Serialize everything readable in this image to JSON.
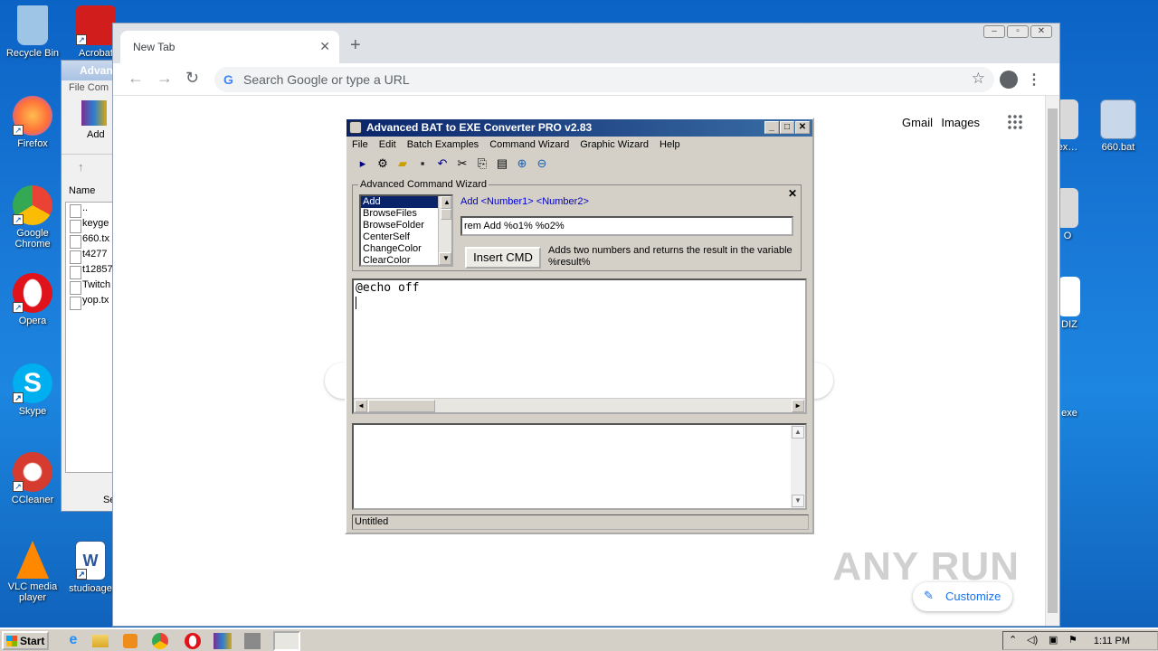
{
  "desktop_icons": [
    {
      "label": "Recycle Bin",
      "icon": "recycle-bin-icon",
      "color": "#9ec4e6"
    },
    {
      "label": "Acrobat",
      "icon": "acrobat-icon",
      "color": "#d21d1d"
    },
    {
      "label": "Firefox",
      "icon": "firefox-icon",
      "color": "#ff7139"
    },
    {
      "label": "Google Chrome",
      "icon": "chrome-icon",
      "color": "#34a853"
    },
    {
      "label": "Opera",
      "icon": "opera-icon",
      "color": "#e0121a"
    },
    {
      "label": "Skype",
      "icon": "skype-icon",
      "color": "#00aff0"
    },
    {
      "label": "CCleaner",
      "icon": "ccleaner-icon",
      "color": "#d63b2f"
    },
    {
      "label": "VLC media player",
      "icon": "vlc-icon",
      "color": "#ff8800"
    },
    {
      "label": "studioage",
      "icon": "word-doc-icon",
      "color": "#2b579a"
    },
    {
      "label": "660.bat",
      "icon": "bat-file-icon",
      "color": "#c8d8ea"
    },
    {
      "label": "ex…",
      "icon": "file-icon",
      "color": "#d9d9d9"
    },
    {
      "label": "O",
      "icon": "file-icon",
      "color": "#d9d9d9"
    },
    {
      "label": "DIZ",
      "icon": "file-icon",
      "color": "#d9d9d9"
    },
    {
      "label": "exe",
      "icon": "exe-icon",
      "color": "#d9d9d9"
    }
  ],
  "explorer": {
    "title": "Advan",
    "menu": "File  Com",
    "add_label": "Add",
    "column_name": "Name",
    "files": [
      "..",
      "keyge",
      "660.tx",
      "t4277",
      "t12857",
      "Twitch",
      "yop.tx"
    ],
    "status": "Se"
  },
  "chrome": {
    "tab_title": "New Tab",
    "omnibox_placeholder": "Search Google or type a URL",
    "gmail": "Gmail",
    "images": "Images",
    "customize": "Customize",
    "watermark": "ANY RUN"
  },
  "bat": {
    "title": "Advanced BAT to EXE Converter PRO v2.83",
    "menu": [
      "File",
      "Edit",
      "Batch Examples",
      "Command Wizard",
      "Graphic Wizard",
      "Help"
    ],
    "wizard_legend": "Advanced Command Wizard",
    "commands": [
      "Add",
      "BrowseFiles",
      "BrowseFolder",
      "CenterSelf",
      "ChangeColor",
      "ClearColor"
    ],
    "selected_command": "Add",
    "syntax": "Add  <Number1> <Number2>",
    "command_input": "rem Add %o1% %o2%",
    "insert_button": "Insert CMD",
    "description": "Adds two numbers and returns the result in the variable %result%",
    "editor_text": "@echo off",
    "status": "Untitled"
  },
  "taskbar": {
    "start": "Start",
    "clock": "1:11 PM"
  }
}
